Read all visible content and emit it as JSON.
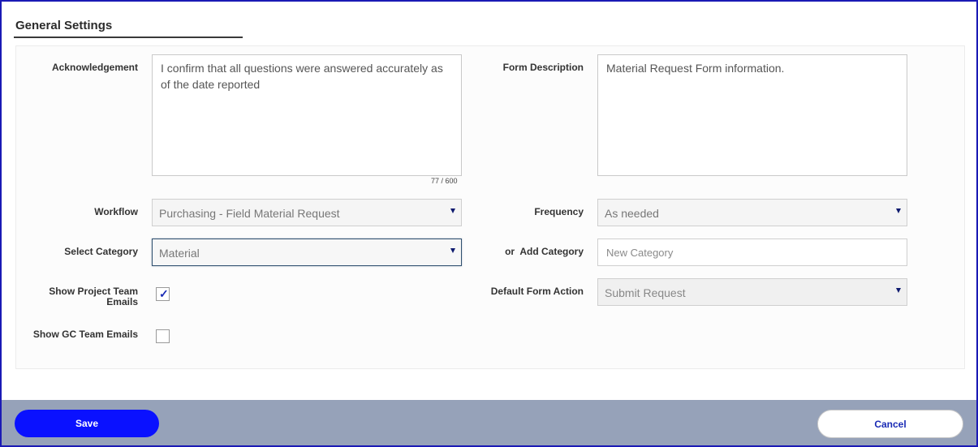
{
  "section": {
    "title": "General Settings"
  },
  "acknowledgement": {
    "label": "Acknowledgement",
    "value": "I confirm that all questions were answered accurately as of the date reported",
    "counter": "77 / 600"
  },
  "form_description": {
    "label": "Form Description",
    "value": "Material Request Form information."
  },
  "workflow": {
    "label": "Workflow",
    "value": "Purchasing - Field Material Request"
  },
  "frequency": {
    "label": "Frequency",
    "value": "As needed"
  },
  "select_category": {
    "label": "Select Category",
    "value": "Material"
  },
  "add_category": {
    "label": "or  Add Category",
    "placeholder": "New Category"
  },
  "show_project_team_emails": {
    "label_line1": "Show Project Team",
    "label_line2": "Emails",
    "checked": true,
    "check_glyph": "✓"
  },
  "default_form_action": {
    "label": "Default Form Action",
    "value": "Submit Request"
  },
  "show_gc_team_emails": {
    "label": "Show GC Team Emails",
    "checked": false
  },
  "footer": {
    "save_label": "Save",
    "cancel_label": "Cancel"
  },
  "colors": {
    "accent": "#0a11ff",
    "footer_bg": "#96a2b9",
    "link": "#1a2bb5"
  }
}
